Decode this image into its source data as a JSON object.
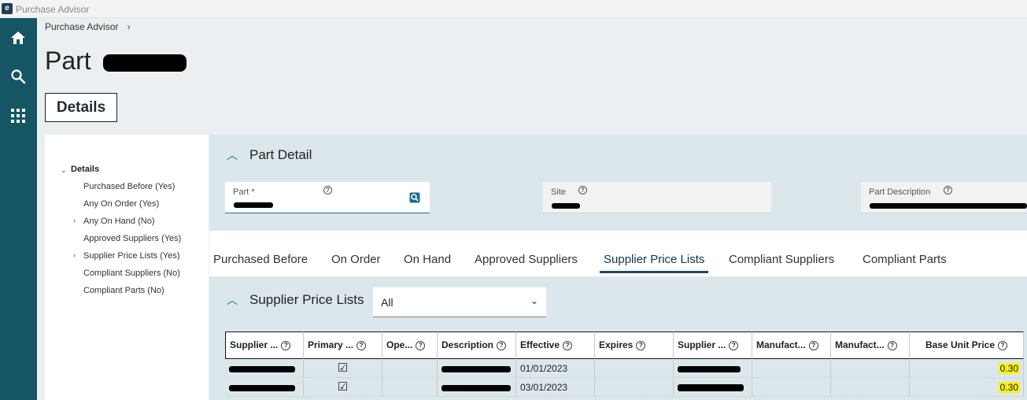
{
  "app": {
    "title": "Purchase Advisor",
    "logo_letter": "e"
  },
  "rail": {
    "items": [
      "home-icon",
      "search-icon",
      "apps-grid-icon"
    ]
  },
  "breadcrumb": {
    "root": "Purchase Advisor",
    "separator": "›"
  },
  "page": {
    "title_prefix": "Part"
  },
  "details_tab": {
    "label": "Details"
  },
  "leftnav": {
    "section": "Details",
    "items": [
      "Purchased Before (Yes)",
      "Any On Order (Yes)",
      "Any On Hand (No)",
      "Approved Suppliers (Yes)",
      "Supplier Price Lists (Yes)",
      "Compliant Suppliers (No)",
      "Compliant Parts (No)"
    ]
  },
  "part_detail": {
    "title": "Part Detail",
    "fields": {
      "part_label": "Part *",
      "site_label": "Site",
      "description_label": "Part Description"
    }
  },
  "tabs": [
    "Purchased Before",
    "On Order",
    "On Hand",
    "Approved Suppliers",
    "Supplier Price Lists",
    "Compliant Suppliers",
    "Compliant Parts"
  ],
  "active_tab": "Supplier Price Lists",
  "price_lists": {
    "title": "Supplier Price Lists",
    "filter_value": "All",
    "columns": [
      "Supplier ...",
      "Primary ...",
      "Ope...",
      "Description",
      "Effective",
      "Expires",
      "Supplier ...",
      "Manufact...",
      "Manufact...",
      "Base Unit Price"
    ],
    "rows": [
      {
        "primary": "☑",
        "effective": "01/01/2023",
        "base_unit_price": "0.30"
      },
      {
        "primary": "☑",
        "effective": "03/01/2023",
        "base_unit_price": "0.30"
      }
    ]
  },
  "colors": {
    "rail": "#165664",
    "accent": "#1a6e94",
    "highlight": "#f6f01c"
  }
}
